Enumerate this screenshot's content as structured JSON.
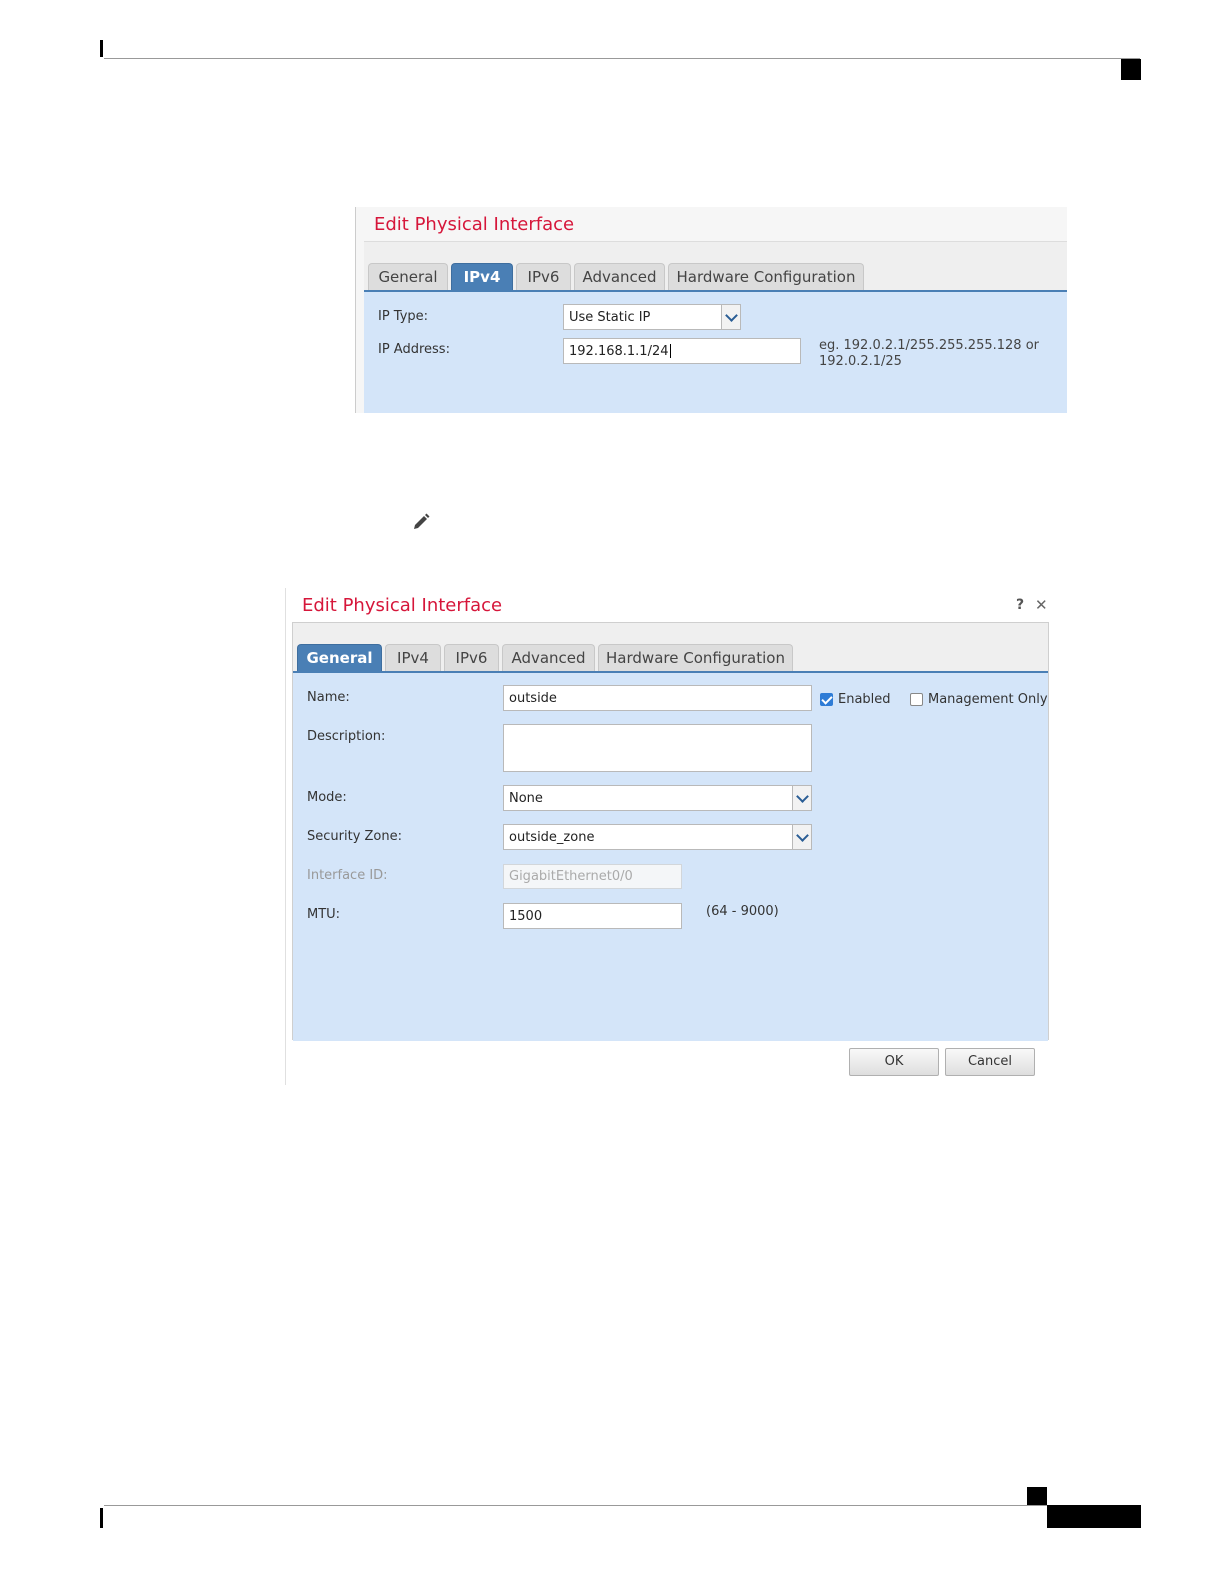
{
  "dialog1": {
    "title": "Edit Physical Interface",
    "tabs": [
      "General",
      "IPv4",
      "IPv6",
      "Advanced",
      "Hardware Configuration"
    ],
    "active_tab": "IPv4",
    "ip_type_label": "IP Type:",
    "ip_type_value": "Use Static IP",
    "ip_address_label": "IP Address:",
    "ip_address_value": "192.168.1.1/24",
    "hint_line1": "eg. 192.0.2.1/255.255.255.128 or",
    "hint_line2": "192.0.2.1/25"
  },
  "edit_icon": "pencil-icon",
  "dialog2": {
    "title": "Edit Physical Interface",
    "help": "?",
    "close": "✕",
    "tabs": [
      "General",
      "IPv4",
      "IPv6",
      "Advanced",
      "Hardware Configuration"
    ],
    "active_tab": "General",
    "name_label": "Name:",
    "name_value": "outside",
    "enabled_label": "Enabled",
    "enabled_checked": true,
    "management_only_label": "Management Only",
    "management_only_checked": false,
    "description_label": "Description:",
    "description_value": "",
    "mode_label": "Mode:",
    "mode_value": "None",
    "security_zone_label": "Security Zone:",
    "security_zone_value": "outside_zone",
    "interface_id_label": "Interface ID:",
    "interface_id_value": "GigabitEthernet0/0",
    "mtu_label": "MTU:",
    "mtu_value": "1500",
    "mtu_range": "(64 - 9000)",
    "ok_label": "OK",
    "cancel_label": "Cancel"
  },
  "colors": {
    "title_red": "#d6163a",
    "active_tab_blue": "#4a7fb5",
    "panel_blue": "#d4e5f9",
    "checkbox_blue": "#2f7cd6"
  }
}
